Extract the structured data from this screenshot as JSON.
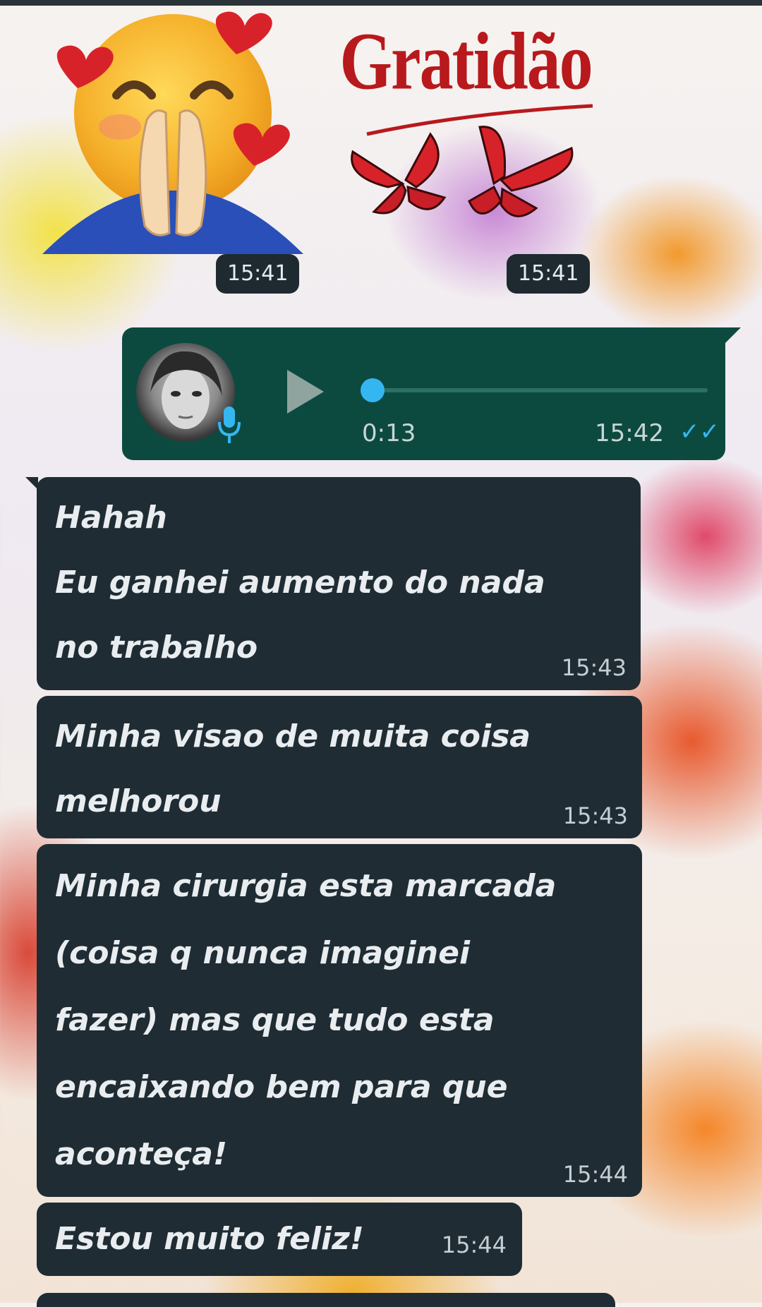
{
  "stickers": {
    "gratitude_text": "Gratidão",
    "time_left": "15:41",
    "time_right": "15:41"
  },
  "voice_message": {
    "duration": "0:13",
    "time": "15:42",
    "status_icon": "double-check-icon",
    "progress": 0
  },
  "messages": [
    {
      "lines": [
        "Hahah",
        "Eu ganhei aumento do nada",
        "no trabalho"
      ],
      "time": "15:43"
    },
    {
      "lines": [
        "Minha visao de muita coisa",
        "melhorou"
      ],
      "time": "15:43"
    },
    {
      "lines": [
        "Minha cirurgia esta marcada",
        "(coisa q nunca imaginei",
        "fazer) mas que tudo esta",
        "encaixando bem para que",
        "aconteça!"
      ],
      "time": "15:44"
    },
    {
      "lines": [
        "Estou muito feliz!"
      ],
      "time": "15:44"
    }
  ],
  "colors": {
    "bubble_incoming": "#1f2c34",
    "bubble_outgoing": "#0c4a40",
    "accent": "#34b7f1",
    "gratitude_red": "#b8191c"
  }
}
